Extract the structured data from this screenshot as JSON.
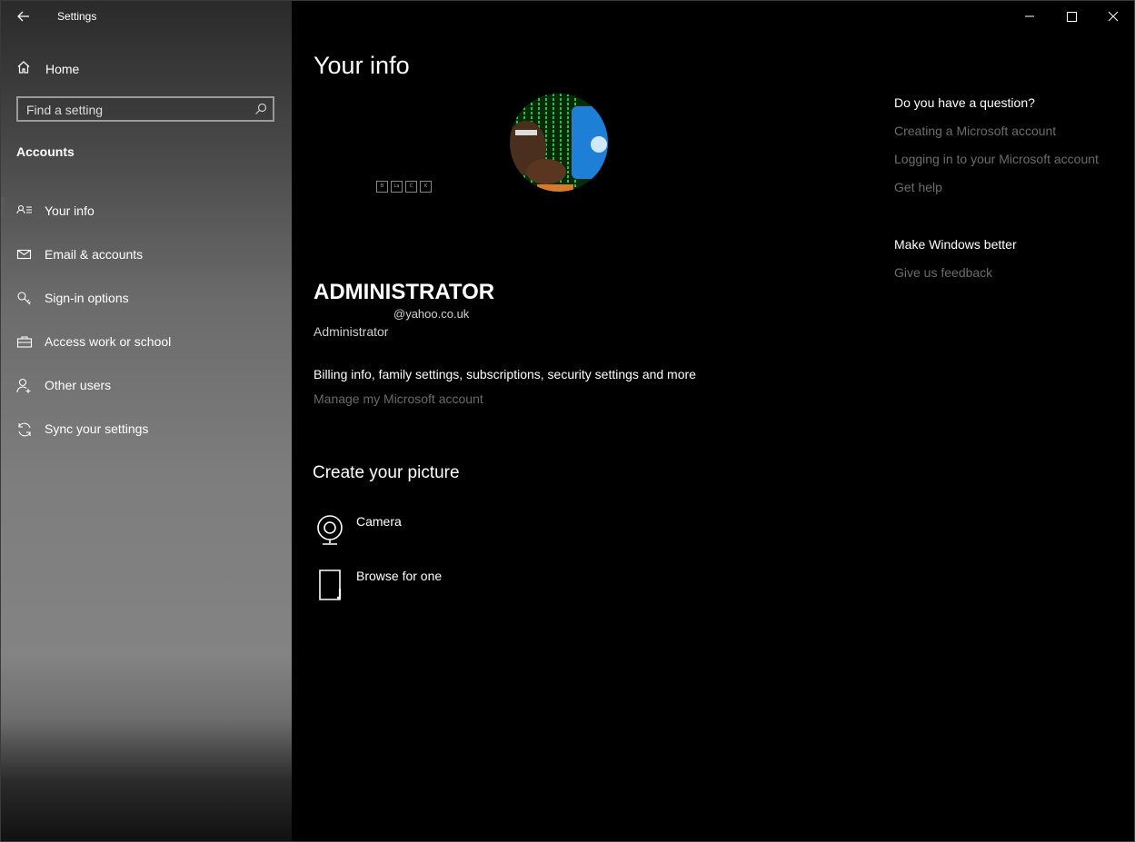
{
  "window": {
    "title": "Settings",
    "controls": [
      "minimize-icon",
      "maximize-icon",
      "close-icon"
    ]
  },
  "sidebar": {
    "home_label": "Home",
    "search_placeholder": "Find a setting",
    "section_title": "Accounts",
    "items": [
      {
        "label": "Your info",
        "icon": "person-list-icon",
        "active": true
      },
      {
        "label": "Email & accounts",
        "icon": "mail-icon",
        "active": false
      },
      {
        "label": "Sign-in options",
        "icon": "key-icon",
        "active": false
      },
      {
        "label": "Access work or school",
        "icon": "briefcase-icon",
        "active": false
      },
      {
        "label": "Other users",
        "icon": "person-add-icon",
        "active": false
      },
      {
        "label": "Sync your settings",
        "icon": "sync-icon",
        "active": false
      }
    ]
  },
  "main": {
    "title": "Your info",
    "user": {
      "name": "ADMINISTRATOR",
      "email": "@yahoo.co.uk",
      "role": "Administrator"
    },
    "badges": [
      "B",
      "La",
      "C",
      "K"
    ],
    "billing_text": "Billing info, family settings, subscriptions, security settings and more",
    "manage_link": "Manage my Microsoft account",
    "picture_section": {
      "title": "Create your picture",
      "options": [
        {
          "label": "Camera",
          "icon": "camera-icon"
        },
        {
          "label": "Browse for one",
          "icon": "browse-file-icon"
        }
      ]
    }
  },
  "help": {
    "title": "Do you have a question?",
    "links": [
      "Creating a Microsoft account",
      "Logging in to your Microsoft account",
      "Get help"
    ]
  },
  "feedback": {
    "title": "Make Windows better",
    "link": "Give us feedback"
  },
  "colors": {
    "background": "#000000",
    "link_disabled": "#6c6c6c",
    "text": "#ffffff"
  }
}
